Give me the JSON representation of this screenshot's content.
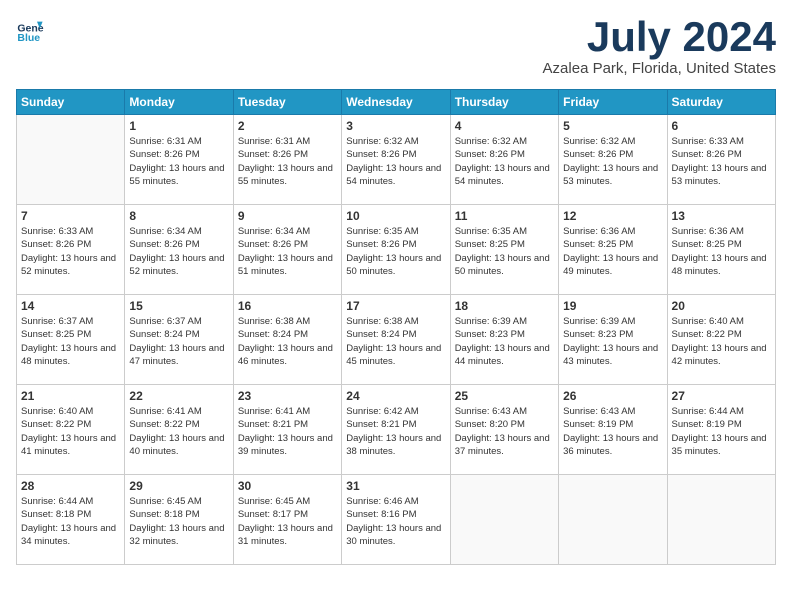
{
  "header": {
    "logo_line1": "General",
    "logo_line2": "Blue",
    "month": "July 2024",
    "location": "Azalea Park, Florida, United States"
  },
  "days_of_week": [
    "Sunday",
    "Monday",
    "Tuesday",
    "Wednesday",
    "Thursday",
    "Friday",
    "Saturday"
  ],
  "weeks": [
    [
      {
        "num": "",
        "sunrise": "",
        "sunset": "",
        "daylight": ""
      },
      {
        "num": "1",
        "sunrise": "Sunrise: 6:31 AM",
        "sunset": "Sunset: 8:26 PM",
        "daylight": "Daylight: 13 hours and 55 minutes."
      },
      {
        "num": "2",
        "sunrise": "Sunrise: 6:31 AM",
        "sunset": "Sunset: 8:26 PM",
        "daylight": "Daylight: 13 hours and 55 minutes."
      },
      {
        "num": "3",
        "sunrise": "Sunrise: 6:32 AM",
        "sunset": "Sunset: 8:26 PM",
        "daylight": "Daylight: 13 hours and 54 minutes."
      },
      {
        "num": "4",
        "sunrise": "Sunrise: 6:32 AM",
        "sunset": "Sunset: 8:26 PM",
        "daylight": "Daylight: 13 hours and 54 minutes."
      },
      {
        "num": "5",
        "sunrise": "Sunrise: 6:32 AM",
        "sunset": "Sunset: 8:26 PM",
        "daylight": "Daylight: 13 hours and 53 minutes."
      },
      {
        "num": "6",
        "sunrise": "Sunrise: 6:33 AM",
        "sunset": "Sunset: 8:26 PM",
        "daylight": "Daylight: 13 hours and 53 minutes."
      }
    ],
    [
      {
        "num": "7",
        "sunrise": "Sunrise: 6:33 AM",
        "sunset": "Sunset: 8:26 PM",
        "daylight": "Daylight: 13 hours and 52 minutes."
      },
      {
        "num": "8",
        "sunrise": "Sunrise: 6:34 AM",
        "sunset": "Sunset: 8:26 PM",
        "daylight": "Daylight: 13 hours and 52 minutes."
      },
      {
        "num": "9",
        "sunrise": "Sunrise: 6:34 AM",
        "sunset": "Sunset: 8:26 PM",
        "daylight": "Daylight: 13 hours and 51 minutes."
      },
      {
        "num": "10",
        "sunrise": "Sunrise: 6:35 AM",
        "sunset": "Sunset: 8:26 PM",
        "daylight": "Daylight: 13 hours and 50 minutes."
      },
      {
        "num": "11",
        "sunrise": "Sunrise: 6:35 AM",
        "sunset": "Sunset: 8:25 PM",
        "daylight": "Daylight: 13 hours and 50 minutes."
      },
      {
        "num": "12",
        "sunrise": "Sunrise: 6:36 AM",
        "sunset": "Sunset: 8:25 PM",
        "daylight": "Daylight: 13 hours and 49 minutes."
      },
      {
        "num": "13",
        "sunrise": "Sunrise: 6:36 AM",
        "sunset": "Sunset: 8:25 PM",
        "daylight": "Daylight: 13 hours and 48 minutes."
      }
    ],
    [
      {
        "num": "14",
        "sunrise": "Sunrise: 6:37 AM",
        "sunset": "Sunset: 8:25 PM",
        "daylight": "Daylight: 13 hours and 48 minutes."
      },
      {
        "num": "15",
        "sunrise": "Sunrise: 6:37 AM",
        "sunset": "Sunset: 8:24 PM",
        "daylight": "Daylight: 13 hours and 47 minutes."
      },
      {
        "num": "16",
        "sunrise": "Sunrise: 6:38 AM",
        "sunset": "Sunset: 8:24 PM",
        "daylight": "Daylight: 13 hours and 46 minutes."
      },
      {
        "num": "17",
        "sunrise": "Sunrise: 6:38 AM",
        "sunset": "Sunset: 8:24 PM",
        "daylight": "Daylight: 13 hours and 45 minutes."
      },
      {
        "num": "18",
        "sunrise": "Sunrise: 6:39 AM",
        "sunset": "Sunset: 8:23 PM",
        "daylight": "Daylight: 13 hours and 44 minutes."
      },
      {
        "num": "19",
        "sunrise": "Sunrise: 6:39 AM",
        "sunset": "Sunset: 8:23 PM",
        "daylight": "Daylight: 13 hours and 43 minutes."
      },
      {
        "num": "20",
        "sunrise": "Sunrise: 6:40 AM",
        "sunset": "Sunset: 8:22 PM",
        "daylight": "Daylight: 13 hours and 42 minutes."
      }
    ],
    [
      {
        "num": "21",
        "sunrise": "Sunrise: 6:40 AM",
        "sunset": "Sunset: 8:22 PM",
        "daylight": "Daylight: 13 hours and 41 minutes."
      },
      {
        "num": "22",
        "sunrise": "Sunrise: 6:41 AM",
        "sunset": "Sunset: 8:22 PM",
        "daylight": "Daylight: 13 hours and 40 minutes."
      },
      {
        "num": "23",
        "sunrise": "Sunrise: 6:41 AM",
        "sunset": "Sunset: 8:21 PM",
        "daylight": "Daylight: 13 hours and 39 minutes."
      },
      {
        "num": "24",
        "sunrise": "Sunrise: 6:42 AM",
        "sunset": "Sunset: 8:21 PM",
        "daylight": "Daylight: 13 hours and 38 minutes."
      },
      {
        "num": "25",
        "sunrise": "Sunrise: 6:43 AM",
        "sunset": "Sunset: 8:20 PM",
        "daylight": "Daylight: 13 hours and 37 minutes."
      },
      {
        "num": "26",
        "sunrise": "Sunrise: 6:43 AM",
        "sunset": "Sunset: 8:19 PM",
        "daylight": "Daylight: 13 hours and 36 minutes."
      },
      {
        "num": "27",
        "sunrise": "Sunrise: 6:44 AM",
        "sunset": "Sunset: 8:19 PM",
        "daylight": "Daylight: 13 hours and 35 minutes."
      }
    ],
    [
      {
        "num": "28",
        "sunrise": "Sunrise: 6:44 AM",
        "sunset": "Sunset: 8:18 PM",
        "daylight": "Daylight: 13 hours and 34 minutes."
      },
      {
        "num": "29",
        "sunrise": "Sunrise: 6:45 AM",
        "sunset": "Sunset: 8:18 PM",
        "daylight": "Daylight: 13 hours and 32 minutes."
      },
      {
        "num": "30",
        "sunrise": "Sunrise: 6:45 AM",
        "sunset": "Sunset: 8:17 PM",
        "daylight": "Daylight: 13 hours and 31 minutes."
      },
      {
        "num": "31",
        "sunrise": "Sunrise: 6:46 AM",
        "sunset": "Sunset: 8:16 PM",
        "daylight": "Daylight: 13 hours and 30 minutes."
      },
      {
        "num": "",
        "sunrise": "",
        "sunset": "",
        "daylight": ""
      },
      {
        "num": "",
        "sunrise": "",
        "sunset": "",
        "daylight": ""
      },
      {
        "num": "",
        "sunrise": "",
        "sunset": "",
        "daylight": ""
      }
    ]
  ]
}
